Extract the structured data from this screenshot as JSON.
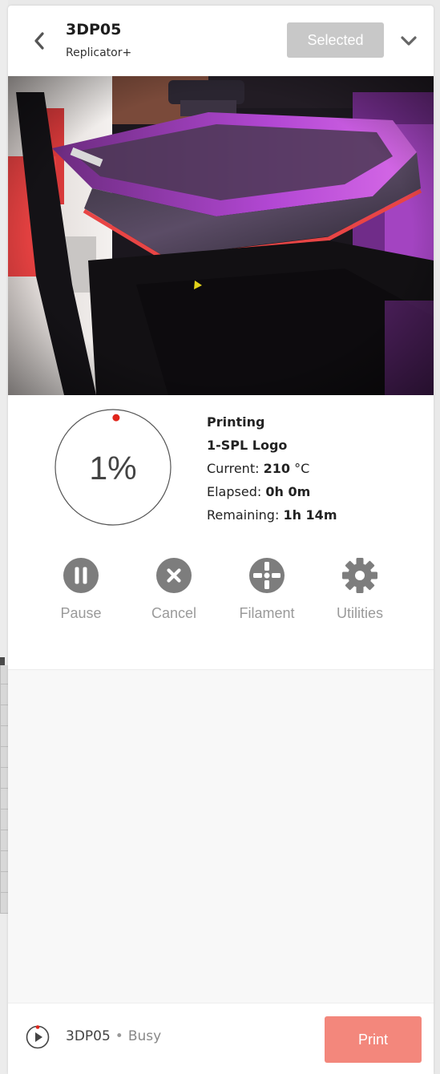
{
  "header": {
    "printer_name": "3DP05",
    "printer_model": "Replicator+",
    "selected_label": "Selected"
  },
  "status": {
    "progress_text": "1%",
    "progress_fraction": 0.01,
    "state": "Printing",
    "job_name": "1-SPL Logo",
    "current_label": "Current:",
    "current_value": "210",
    "current_unit": "°C",
    "elapsed_label": "Elapsed:",
    "elapsed_value": "0h 0m",
    "remaining_label": "Remaining:",
    "remaining_value": "1h 14m"
  },
  "actions": [
    {
      "label": "Pause",
      "icon": "pause-icon"
    },
    {
      "label": "Cancel",
      "icon": "close-icon"
    },
    {
      "label": "Filament",
      "icon": "filament-icon"
    },
    {
      "label": "Utilities",
      "icon": "gear-icon"
    }
  ],
  "footer": {
    "printer_name": "3DP05",
    "separator": "•",
    "status": "Busy",
    "print_label": "Print"
  },
  "colors": {
    "accent": "#f3877c",
    "progress_dot": "#e0251b",
    "icon_gray": "#7d7d7d",
    "disabled_button": "#c8c8c8"
  }
}
